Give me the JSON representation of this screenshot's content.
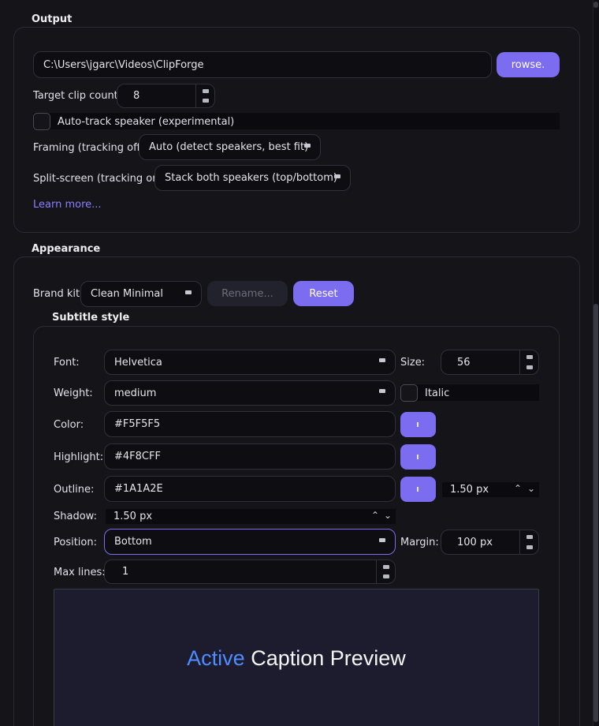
{
  "output": {
    "title": "Output",
    "path_value": "C:\\Users\\jgarc\\Videos\\ClipForge",
    "browse_label": "rowse.",
    "clip_count_label": "Target clip count:",
    "clip_count_value": "8",
    "autotrack_label": "Auto-track speaker (experimental)",
    "framing_label": "Framing (tracking off):",
    "framing_value": "Auto (detect speakers, best fit)",
    "split_label": "Split-screen (tracking on):",
    "split_value": "Stack both speakers (top/bottom)",
    "learn_more": "Learn more..."
  },
  "appearance": {
    "title": "Appearance",
    "brand_kit_label": "Brand kit:",
    "brand_kit_value": "Clean Minimal",
    "rename_label": "Rename...",
    "reset_label": "Reset"
  },
  "subtitle": {
    "title": "Subtitle style",
    "font_label": "Font:",
    "font_value": "Helvetica",
    "size_label": "Size:",
    "size_value": "56",
    "weight_label": "Weight:",
    "weight_value": "medium",
    "italic_label": "Italic",
    "color_label": "Color:",
    "color_value": "#F5F5F5",
    "highlight_label": "Highlight:",
    "highlight_value": "#4F8CFF",
    "outline_label": "Outline:",
    "outline_value": "#1A1A2E",
    "outline_width": "1.50 px",
    "shadow_label": "Shadow:",
    "shadow_value": "1.50 px",
    "position_label": "Position:",
    "position_value": "Bottom",
    "margin_label": "Margin:",
    "margin_value": "100 px",
    "max_lines_label": "Max lines:",
    "max_lines_value": "1"
  },
  "preview": {
    "highlight_word": "Active",
    "rest_text": " Caption Preview"
  },
  "colors": {
    "accent": "#7B6CF0",
    "text_color": "#F5F5F5",
    "highlight_color": "#4F8CFF",
    "outline_color": "#1A1A2E"
  }
}
